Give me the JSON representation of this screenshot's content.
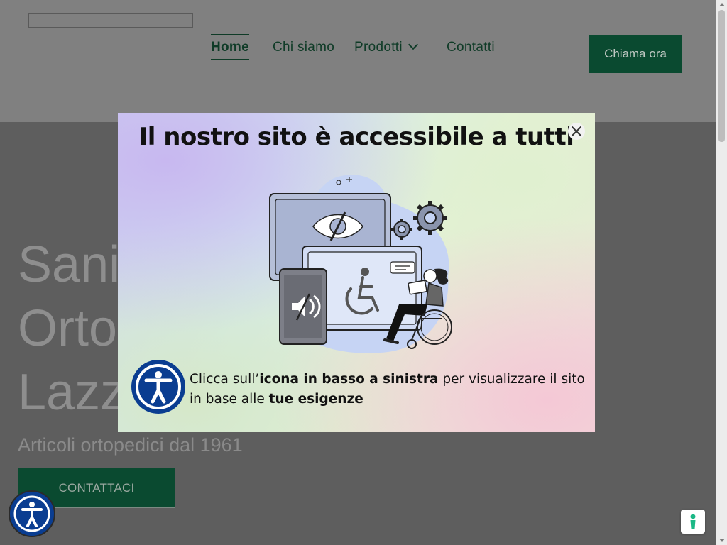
{
  "header": {
    "nav": [
      {
        "label": "Home",
        "active": true
      },
      {
        "label": "Chi siamo",
        "active": false
      },
      {
        "label": "Prodotti",
        "active": false,
        "has_dropdown": true
      },
      {
        "label": "Contatti",
        "active": false
      }
    ],
    "call_button": "Chiama ora"
  },
  "hero": {
    "title_lines": [
      "Sanit",
      "Orto",
      "Lazza"
    ],
    "subtitle": "Articoli ortopedici dal 1961",
    "cta": "CONTATTACI"
  },
  "modal": {
    "title": "Il nostro sito è accessibile a tutti",
    "text_part1": "Clicca sull’",
    "text_bold1": "icona in basso a sinistra",
    "text_part2": " per visualizzare il sito in base alle ",
    "text_bold2": "tue esigenze"
  },
  "colors": {
    "brand_green": "#0a4a30",
    "accessibility_blue": "#0a3d91"
  },
  "icons": {
    "close": "close-icon",
    "accessibility": "accessibility-icon",
    "cookie": "cookie-icon",
    "dropdown": "chevron-down-icon"
  }
}
